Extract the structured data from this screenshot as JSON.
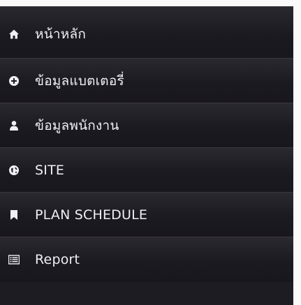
{
  "menu": {
    "items": [
      {
        "label": "หน้าหลัก",
        "icon": "home-icon"
      },
      {
        "label": "ข้อมูลแบตเตอรี่",
        "icon": "plus-circle-icon"
      },
      {
        "label": "ข้อมูลพนักงาน",
        "icon": "user-icon"
      },
      {
        "label": "SITE",
        "icon": "globe-icon"
      },
      {
        "label": "PLAN SCHEDULE",
        "icon": "bookmark-icon"
      },
      {
        "label": "Report",
        "icon": "list-icon"
      }
    ]
  },
  "colors": {
    "menu_background": "#1e1c23",
    "text": "#eef0f5",
    "divider": "#3a383e"
  }
}
